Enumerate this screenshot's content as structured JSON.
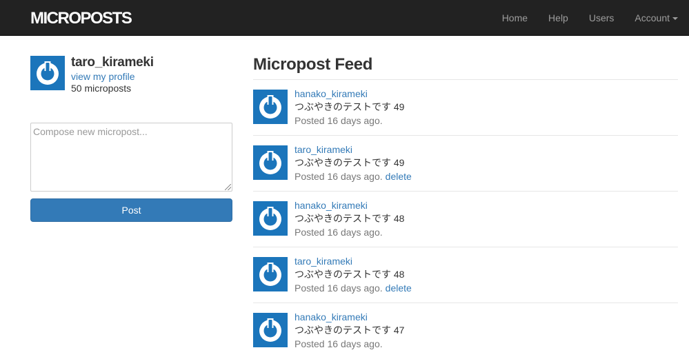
{
  "navbar": {
    "logo": "MICROPOSTS",
    "links": [
      "Home",
      "Help",
      "Users",
      "Account"
    ]
  },
  "sidebar": {
    "user_name": "taro_kirameki",
    "profile_link": "view my profile",
    "micropost_count": "50 microposts",
    "compose_placeholder": "Compose new micropost...",
    "post_button": "Post"
  },
  "feed": {
    "title": "Micropost Feed",
    "items": [
      {
        "user": "hanako_kirameki",
        "content": "つぶやきのテストです 49",
        "time": "Posted 16 days ago.",
        "delete": ""
      },
      {
        "user": "taro_kirameki",
        "content": "つぶやきのテストです 49",
        "time": "Posted 16 days ago.",
        "delete": "delete"
      },
      {
        "user": "hanako_kirameki",
        "content": "つぶやきのテストです 48",
        "time": "Posted 16 days ago.",
        "delete": ""
      },
      {
        "user": "taro_kirameki",
        "content": "つぶやきのテストです 48",
        "time": "Posted 16 days ago.",
        "delete": "delete"
      },
      {
        "user": "hanako_kirameki",
        "content": "つぶやきのテストです 47",
        "time": "Posted 16 days ago.",
        "delete": ""
      }
    ]
  },
  "icons": {
    "avatar": "power-icon"
  },
  "colors": {
    "navbar_bg": "#222222",
    "link": "#337ab7",
    "gravatar_bg": "#1b75bb",
    "button": "#337ab7"
  }
}
